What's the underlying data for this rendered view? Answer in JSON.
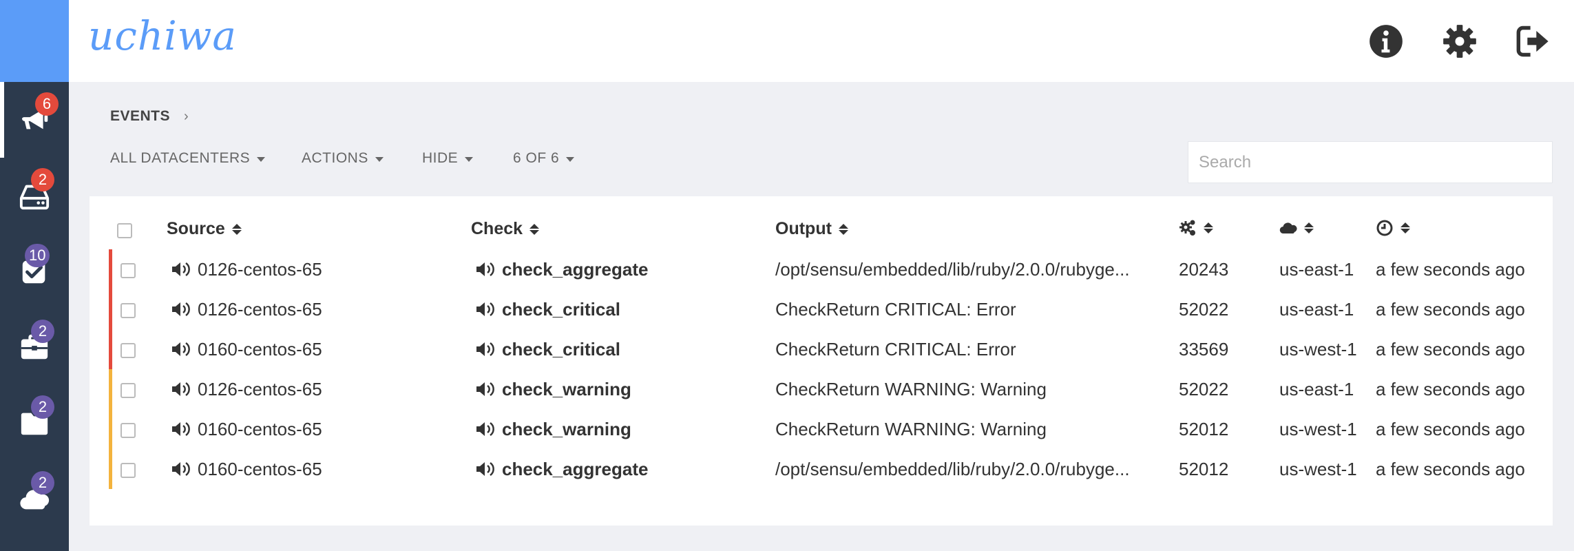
{
  "app": {
    "brand": "uchiwa"
  },
  "sidebar": {
    "items": [
      {
        "name": "events",
        "icon": "bullhorn-icon",
        "badge": "6",
        "badge_color": "#e44a3c"
      },
      {
        "name": "clients",
        "icon": "hdd-icon",
        "badge": "2",
        "badge_color": "#e44a3c"
      },
      {
        "name": "checks",
        "icon": "check-square-icon",
        "badge": "10",
        "badge_color": "#6a5aa8"
      },
      {
        "name": "stashes",
        "icon": "briefcase-icon",
        "badge": "2",
        "badge_color": "#6a5aa8"
      },
      {
        "name": "aggregates",
        "icon": "folder-icon",
        "badge": "2",
        "badge_color": "#6a5aa8"
      },
      {
        "name": "datacenters",
        "icon": "cloud-icon",
        "badge": "2",
        "badge_color": "#6a5aa8"
      }
    ]
  },
  "header": {
    "icons": [
      "info-circle-icon",
      "gear-icon",
      "sign-out-icon"
    ]
  },
  "breadcrumb": {
    "label": "EVENTS",
    "separator": "›"
  },
  "toolbar": {
    "datacenters": "ALL DATACENTERS",
    "actions": "ACTIONS",
    "hide": "HIDE",
    "limit": "6 OF 6"
  },
  "search": {
    "placeholder": "Search",
    "value": ""
  },
  "table": {
    "headers": {
      "source": "Source",
      "check": "Check",
      "output": "Output",
      "occurrences_icon": "gears-icon",
      "datacenter_icon": "cloud-icon",
      "time_icon": "clock-icon"
    },
    "rows": [
      {
        "status": "critical",
        "source": "0126-centos-65",
        "check": "check_aggregate",
        "output": "/opt/sensu/embedded/lib/ruby/2.0.0/rubyge...",
        "occurrences": "20243",
        "datacenter": "us-east-1",
        "time": "a few seconds ago"
      },
      {
        "status": "critical",
        "source": "0126-centos-65",
        "check": "check_critical",
        "output": "CheckReturn CRITICAL: Error",
        "occurrences": "52022",
        "datacenter": "us-east-1",
        "time": "a few seconds ago"
      },
      {
        "status": "critical",
        "source": "0160-centos-65",
        "check": "check_critical",
        "output": "CheckReturn CRITICAL: Error",
        "occurrences": "33569",
        "datacenter": "us-west-1",
        "time": "a few seconds ago"
      },
      {
        "status": "warning",
        "source": "0126-centos-65",
        "check": "check_warning",
        "output": "CheckReturn WARNING: Warning",
        "occurrences": "52022",
        "datacenter": "us-east-1",
        "time": "a few seconds ago"
      },
      {
        "status": "warning",
        "source": "0160-centos-65",
        "check": "check_warning",
        "output": "CheckReturn WARNING: Warning",
        "occurrences": "52012",
        "datacenter": "us-west-1",
        "time": "a few seconds ago"
      },
      {
        "status": "warning",
        "source": "0160-centos-65",
        "check": "check_aggregate",
        "output": "/opt/sensu/embedded/lib/ruby/2.0.0/rubyge...",
        "occurrences": "52012",
        "datacenter": "us-west-1",
        "time": "a few seconds ago"
      }
    ]
  },
  "colors": {
    "critical": "#e44a3c",
    "warning": "#f3b33d",
    "accent": "#5b9cf8",
    "sidebar": "#2c3a4d"
  }
}
